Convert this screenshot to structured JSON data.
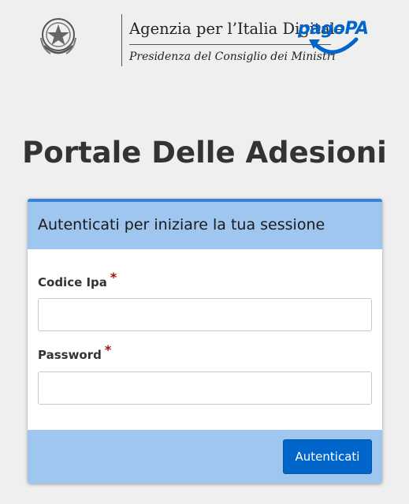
{
  "header": {
    "agency_name": "Agenzia per l’Italia Digitale",
    "agency_subtitle": "Presidenza del Consiglio dei Ministri",
    "brand_logo_text": "pagoPA",
    "emblem_icon": "italian-republic-emblem-icon",
    "brand_color": "#0066cc"
  },
  "title": {
    "parts": [
      {
        "bold": "P",
        "rest": "ortale "
      },
      {
        "bold": "D",
        "rest": "elle "
      },
      {
        "bold": "A",
        "rest": "desioni"
      }
    ],
    "p1_bold": "P",
    "p1_rest": "ortale ",
    "p2_bold": "D",
    "p2_rest": "elle ",
    "p3_bold": "A",
    "p3_rest": "desioni"
  },
  "login": {
    "heading": "Autenticati per iniziare la tua sessione",
    "fields": {
      "codice_ipa": {
        "label": "Codice Ipa",
        "required_mark": "*",
        "value": ""
      },
      "password": {
        "label": "Password",
        "required_mark": "*",
        "value": ""
      }
    },
    "submit_label": "Autenticati",
    "colors": {
      "accent": "#0066cc",
      "header_bg": "#9fc6ee",
      "required": "#a01010"
    }
  }
}
